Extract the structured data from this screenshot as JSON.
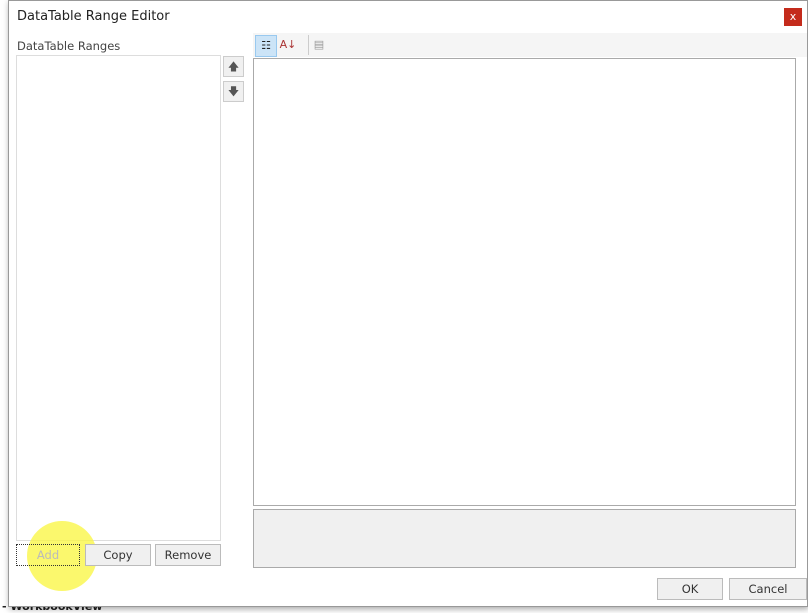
{
  "background": {
    "text": "- WorkbookView"
  },
  "dialog": {
    "title": "DataTable Range Editor",
    "close": "x",
    "ranges_label": "DataTable Ranges",
    "move_up": "🡅",
    "move_down": "🡇",
    "buttons": {
      "add": "Add",
      "copy": "Copy",
      "remove": "Remove",
      "ok": "OK",
      "cancel": "Cancel"
    },
    "toolbar": {
      "categorized": "☷",
      "alphabetical": "A↓",
      "property_pages": "▤"
    }
  }
}
